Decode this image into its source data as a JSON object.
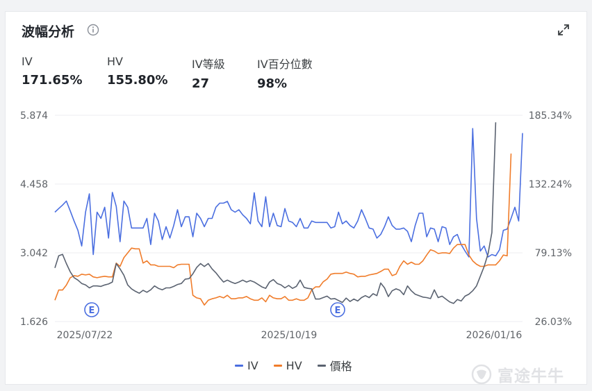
{
  "header": {
    "title": "波幅分析"
  },
  "stats": [
    {
      "label": "IV",
      "value": "171.65%"
    },
    {
      "label": "HV",
      "value": "155.80%"
    },
    {
      "label": "IV等級",
      "value": "27"
    },
    {
      "label": "IV百分位數",
      "value": "98%"
    }
  ],
  "chart_data": {
    "type": "line",
    "x_ticks": [
      "2025/07/22",
      "2025/10/19",
      "2026/01/16"
    ],
    "left_axis": {
      "ticks": [
        "5.874",
        "4.458",
        "3.042",
        "1.626"
      ],
      "range": [
        1.626,
        5.874
      ]
    },
    "right_axis": {
      "ticks": [
        "185.34%",
        "132.24%",
        "79.13%",
        "26.03%"
      ],
      "range": [
        26.03,
        185.34
      ]
    },
    "earnings_markers": [
      {
        "label": "E",
        "date": "2025/07/29"
      },
      {
        "label": "E",
        "date": "2025/11/01"
      }
    ],
    "series": [
      {
        "name": "IV",
        "axis": "right",
        "color": "#4a6ee0",
        "values": [
          110.5,
          113.3,
          116.0,
          119.1,
          111.5,
          103.7,
          96.5,
          84.4,
          110.5,
          124.7,
          77.8,
          110.5,
          105.7,
          114.3,
          90.5,
          125.8,
          114.9,
          87.7,
          119.1,
          114.3,
          98.3,
          98.3,
          98.3,
          98.3,
          105.7,
          85.5,
          109.7,
          103.7,
          89.3,
          99.3,
          90.5,
          100.2,
          112.4,
          99.3,
          106.9,
          106.9,
          91.5,
          109.7,
          105.7,
          99.3,
          105.7,
          105.7,
          114.3,
          117.5,
          117.5,
          118.8,
          112.4,
          110.5,
          112.4,
          108.5,
          105.7,
          101.5,
          125.5,
          103.7,
          99.3,
          122.4,
          99.3,
          109.7,
          100.2,
          99.3,
          113.3,
          103.7,
          102.6,
          99.3,
          105.7,
          98.3,
          98.3,
          103.7,
          102.6,
          102.6,
          102.6,
          102.6,
          98.3,
          99.3,
          110.5,
          101.5,
          103.7,
          100.2,
          98.3,
          103.7,
          112.4,
          105.7,
          98.3,
          97.4,
          90.5,
          93.3,
          99.3,
          106.9,
          100.2,
          97.4,
          97.4,
          98.3,
          95.7,
          87.7,
          100.2,
          109.7,
          109.7,
          91.5,
          98.3,
          97.4,
          87.7,
          99.3,
          98.3,
          85.5,
          91.5,
          93.3,
          85.5,
          80.5,
          75.9,
          175.1,
          105.7,
          80.5,
          84.4,
          75.9,
          77.8,
          76.8,
          81.5,
          96.5,
          97.4,
          105.7,
          114.3,
          103.7,
          171.6
        ]
      },
      {
        "name": "HV",
        "axis": "right",
        "color": "#f07c2a",
        "values": [
          42.5,
          50.4,
          50.4,
          54.2,
          59.9,
          61.5,
          61.0,
          62.6,
          62.0,
          62.6,
          60.5,
          59.9,
          60.5,
          61.0,
          60.5,
          60.5,
          71.2,
          68.7,
          75.4,
          79.1,
          82.8,
          82.2,
          82.2,
          71.2,
          72.9,
          69.8,
          69.8,
          68.7,
          68.7,
          68.7,
          68.7,
          67.6,
          69.8,
          70.3,
          70.3,
          70.3,
          46.3,
          44.3,
          43.6,
          38.8,
          42.5,
          43.6,
          44.3,
          45.4,
          44.3,
          46.3,
          43.6,
          43.6,
          44.3,
          44.3,
          45.4,
          43.6,
          42.5,
          42.5,
          44.3,
          41.3,
          46.3,
          44.3,
          43.6,
          43.6,
          45.4,
          42.5,
          42.5,
          43.6,
          42.5,
          42.5,
          44.3,
          50.4,
          52.8,
          52.8,
          56.7,
          58.8,
          62.6,
          63.2,
          63.2,
          63.2,
          64.2,
          63.2,
          62.6,
          60.5,
          61.0,
          61.0,
          62.0,
          62.6,
          63.2,
          64.7,
          66.5,
          66.5,
          61.5,
          62.6,
          68.7,
          72.9,
          70.3,
          71.9,
          70.3,
          70.3,
          72.9,
          77.4,
          81.5,
          80.5,
          78.6,
          79.1,
          79.1,
          78.6,
          82.8,
          85.5,
          85.5,
          85.5,
          77.4,
          72.9,
          70.3,
          68.7,
          68.7,
          69.8,
          69.8,
          69.8,
          72.9,
          77.4,
          76.8,
          155.8
        ]
      },
      {
        "name": "價格",
        "axis": "left",
        "color": "#5a6270",
        "values": [
          2.73,
          2.98,
          3.01,
          2.82,
          2.65,
          2.53,
          2.48,
          2.41,
          2.38,
          2.32,
          2.36,
          2.36,
          2.35,
          2.38,
          2.4,
          2.44,
          2.82,
          2.71,
          2.58,
          2.38,
          2.3,
          2.25,
          2.21,
          2.27,
          2.23,
          2.28,
          2.36,
          2.31,
          2.28,
          2.32,
          2.32,
          2.35,
          2.39,
          2.41,
          2.5,
          2.51,
          2.61,
          2.74,
          2.82,
          2.76,
          2.82,
          2.71,
          2.63,
          2.53,
          2.44,
          2.48,
          2.44,
          2.41,
          2.44,
          2.48,
          2.44,
          2.47,
          2.44,
          2.39,
          2.34,
          2.31,
          2.44,
          2.49,
          2.41,
          2.38,
          2.32,
          2.37,
          2.31,
          2.35,
          2.48,
          2.33,
          2.31,
          2.3,
          2.09,
          2.09,
          2.12,
          2.15,
          2.09,
          2.1,
          2.06,
          2.02,
          2.11,
          2.04,
          2.09,
          2.05,
          2.12,
          2.16,
          2.12,
          2.2,
          2.16,
          2.42,
          2.32,
          2.14,
          2.26,
          2.3,
          2.27,
          2.18,
          2.36,
          2.26,
          2.19,
          2.16,
          2.13,
          2.12,
          2.1,
          2.28,
          2.12,
          2.15,
          2.09,
          2.03,
          2.0,
          2.08,
          2.05,
          2.15,
          2.19,
          2.26,
          2.36,
          2.56,
          2.76,
          3.02,
          3.46,
          5.73
        ]
      }
    ]
  },
  "legend": [
    {
      "name": "IV",
      "color": "#4a6ee0"
    },
    {
      "name": "HV",
      "color": "#f07c2a"
    },
    {
      "name": "價格",
      "color": "#5a6270"
    }
  ],
  "watermark": {
    "text": "富途牛牛"
  }
}
